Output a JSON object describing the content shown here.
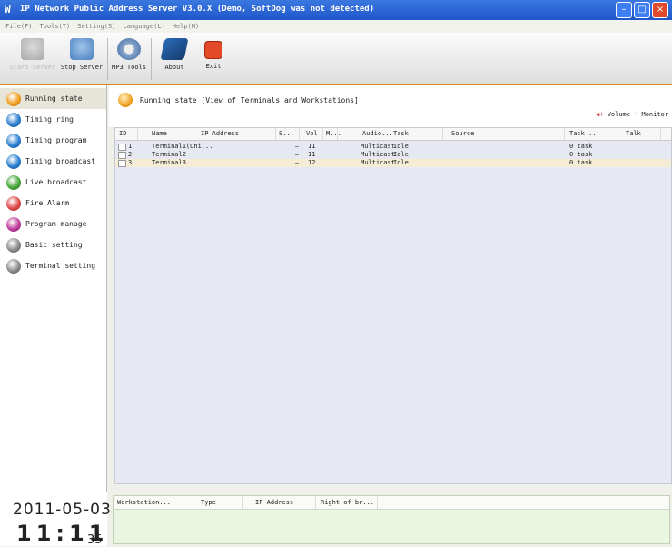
{
  "window": {
    "title": "IP Network Public Address Server V3.0.X (Demo, SoftDog was not detected)",
    "logo": "W",
    "minimize_glyph": "–",
    "maximize_glyph": "□",
    "close_glyph": "×"
  },
  "menu": [
    "File(F)",
    "Tools(T)",
    "Setting(S)",
    "Language(L)",
    "Help(H)"
  ],
  "toolbar": {
    "start_label": "Start Server",
    "stop_label": "Stop Server",
    "mp3_label": "MP3 Tools",
    "about_label": "About",
    "exit_label": "Exit"
  },
  "sidebar": {
    "items": [
      {
        "label": "Running state",
        "icon": "running-state-icon",
        "color": "#f0a020"
      },
      {
        "label": "Timing ring",
        "icon": "timing-ring-icon",
        "color": "#2b7fd0"
      },
      {
        "label": "Timing program",
        "icon": "timing-program-icon",
        "color": "#2b7fd0"
      },
      {
        "label": "Timing broadcast",
        "icon": "timing-broadcast-icon",
        "color": "#2b7fd0"
      },
      {
        "label": "Live broadcast",
        "icon": "live-broadcast-icon",
        "color": "#46a83a"
      },
      {
        "label": "Fire Alarm",
        "icon": "fire-alarm-icon",
        "color": "#e04a4a"
      },
      {
        "label": "Program manage",
        "icon": "program-manage-icon",
        "color": "#c03c9c"
      },
      {
        "label": "Basic setting",
        "icon": "basic-setting-icon",
        "color": "#8a8a8a"
      },
      {
        "label": "Terminal setting",
        "icon": "terminal-setting-icon",
        "color": "#8a8a8a"
      }
    ]
  },
  "header": {
    "title": "Running state [View of Terminals and Workstations]",
    "volume_label": "Volume",
    "monitor_label": "Monitor"
  },
  "table": {
    "columns": [
      "ID",
      "Name",
      "IP Address",
      "S...",
      "Vol",
      "M...",
      "Audio...",
      "Task",
      "Source",
      "Task ...",
      "Talk"
    ],
    "rows": [
      {
        "id": "1",
        "name": "Terminal1(Uni...",
        "ip": "",
        "s": "—",
        "vol": "11",
        "m": "",
        "audio": "Multicast",
        "task": "Idle",
        "source": "",
        "task2": "0 task",
        "talk": ""
      },
      {
        "id": "2",
        "name": "Terminal2",
        "ip": "",
        "s": "—",
        "vol": "11",
        "m": "",
        "audio": "Multicast",
        "task": "Idle",
        "source": "",
        "task2": "0 task",
        "talk": ""
      },
      {
        "id": "3",
        "name": "Terminal3",
        "ip": "",
        "s": "—",
        "vol": "12",
        "m": "",
        "audio": "Multicast",
        "task": "Idle",
        "source": "",
        "task2": "0 task",
        "talk": ""
      }
    ]
  },
  "workstations": {
    "columns": [
      "Workstation...",
      "Type",
      "IP Address",
      "Right of br..."
    ]
  },
  "clock": {
    "date": "2011-05-03",
    "time": "11:11",
    "seconds": "35"
  }
}
